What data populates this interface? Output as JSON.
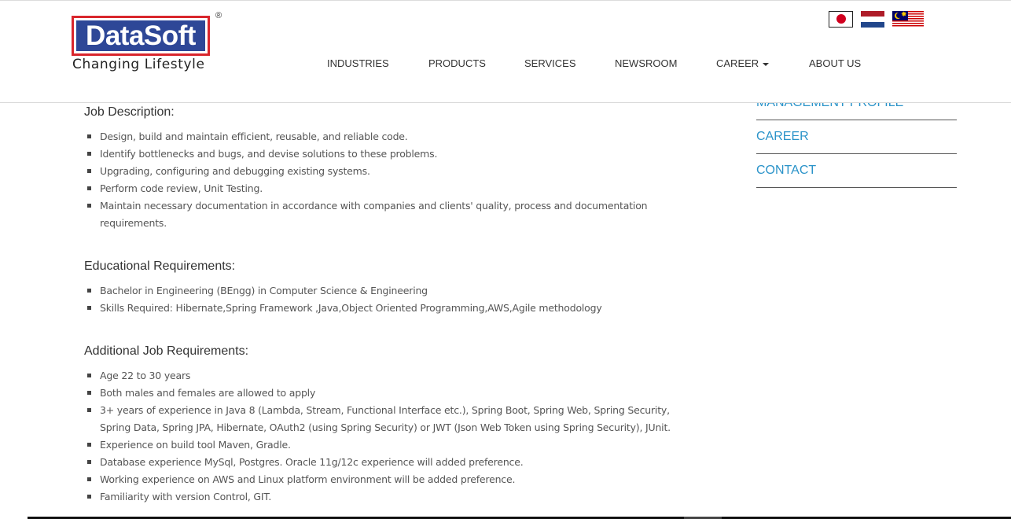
{
  "header": {
    "logo": {
      "name": "DataSoft",
      "tagline": "Changing Lifestyle",
      "registered_mark": "®"
    },
    "nav": [
      {
        "label": "INDUSTRIES"
      },
      {
        "label": "PRODUCTS"
      },
      {
        "label": "SERVICES"
      },
      {
        "label": "NEWSROOM"
      },
      {
        "label": "CAREER",
        "dropdown": true
      },
      {
        "label": "ABOUT US"
      }
    ],
    "flags": [
      "japan-flag-icon",
      "netherlands-flag-icon",
      "malaysia-flag-icon"
    ]
  },
  "sidebar": {
    "items": [
      {
        "label": "MANAGEMENT PROFILE"
      },
      {
        "label": "CAREER"
      },
      {
        "label": "CONTACT"
      }
    ]
  },
  "job": {
    "description": {
      "title": "Job Description:",
      "items": [
        "Design, build and maintain efficient, reusable, and reliable code.",
        "Identify bottlenecks and bugs, and devise solutions to these problems.",
        "Upgrading, configuring and debugging existing systems.",
        "Perform code review, Unit Testing.",
        "Maintain necessary documentation in accordance with companies and clients' quality, process and documentation requirements."
      ]
    },
    "education": {
      "title": "Educational Requirements:",
      "items": [
        "Bachelor in Engineering (BEngg) in Computer Science & Engineering",
        "Skills Required: Hibernate,Spring Framework ,Java,Object Oriented Programming,AWS,Agile methodology"
      ]
    },
    "additional": {
      "title": "Additional Job Requirements:",
      "items": [
        "Age 22 to 30 years",
        "Both males and females are allowed to apply",
        "3+ years of experience in Java 8 (Lambda, Stream, Functional Interface etc.), Spring Boot, Spring Web, Spring Security, Spring Data, Spring JPA, Hibernate, OAuth2 (using Spring Security) or JWT (Json Web Token using Spring Security), JUnit.",
        "Experience on build tool Maven, Gradle.",
        "Database experience MySql, Postgres. Oracle 11g/12c experience will added preference.",
        "Working experience on AWS and Linux platform environment will be added preference.",
        "Familiarity with version Control, GIT."
      ]
    }
  }
}
